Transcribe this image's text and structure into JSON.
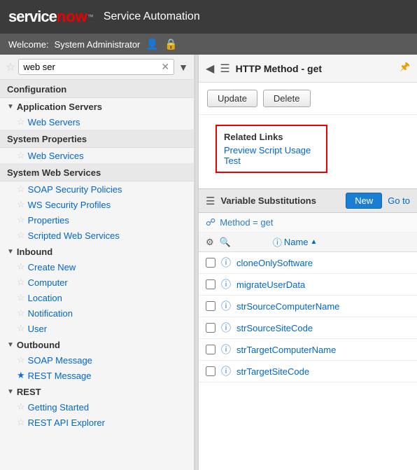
{
  "header": {
    "logo_service": "service",
    "logo_now": "now",
    "logo_tm": "™",
    "title": "Service Automation"
  },
  "welcome_bar": {
    "label": "Welcome:",
    "user": "System Administrator"
  },
  "sidebar": {
    "search_value": "web ser",
    "sections": [
      {
        "type": "title",
        "label": "Configuration"
      },
      {
        "type": "group",
        "label": "Application Servers",
        "expanded": true
      },
      {
        "type": "item",
        "label": "Web Servers",
        "starred": false
      },
      {
        "type": "title",
        "label": "System Properties"
      },
      {
        "type": "item",
        "label": "Web Services",
        "starred": false
      },
      {
        "type": "title",
        "label": "System Web Services"
      },
      {
        "type": "item",
        "label": "SOAP Security Policies",
        "starred": false
      },
      {
        "type": "item",
        "label": "WS Security Profiles",
        "starred": false
      },
      {
        "type": "item",
        "label": "Properties",
        "starred": false
      },
      {
        "type": "item",
        "label": "Scripted Web Services",
        "starred": false
      },
      {
        "type": "group",
        "label": "Inbound",
        "expanded": true
      },
      {
        "type": "item",
        "label": "Create New",
        "starred": false
      },
      {
        "type": "item",
        "label": "Computer",
        "starred": false
      },
      {
        "type": "item",
        "label": "Location",
        "starred": false
      },
      {
        "type": "item",
        "label": "Notification",
        "starred": false
      },
      {
        "type": "item",
        "label": "User",
        "starred": false
      },
      {
        "type": "group",
        "label": "Outbound",
        "expanded": true
      },
      {
        "type": "item",
        "label": "SOAP Message",
        "starred": false
      },
      {
        "type": "item",
        "label": "REST Message",
        "starred": true
      },
      {
        "type": "group",
        "label": "REST",
        "expanded": true
      },
      {
        "type": "item",
        "label": "Getting Started",
        "starred": false
      },
      {
        "type": "item",
        "label": "REST API Explorer",
        "starred": false
      }
    ]
  },
  "content": {
    "header_title": "HTTP Method - get",
    "buttons": {
      "update": "Update",
      "delete": "Delete"
    },
    "related_links": {
      "title": "Related Links",
      "links": [
        "Preview Script Usage",
        "Test"
      ]
    },
    "var_section": {
      "title": "Variable Substitutions",
      "new_label": "New",
      "goto_label": "Go to",
      "filter": "Method = get",
      "col_name": "Name",
      "rows": [
        {
          "name": "cloneOnlySoftware"
        },
        {
          "name": "migrateUserData"
        },
        {
          "name": "strSourceComputerName"
        },
        {
          "name": "strSourceSiteCode"
        },
        {
          "name": "strTargetComputerName"
        },
        {
          "name": "strTargetSiteCode"
        }
      ]
    }
  }
}
